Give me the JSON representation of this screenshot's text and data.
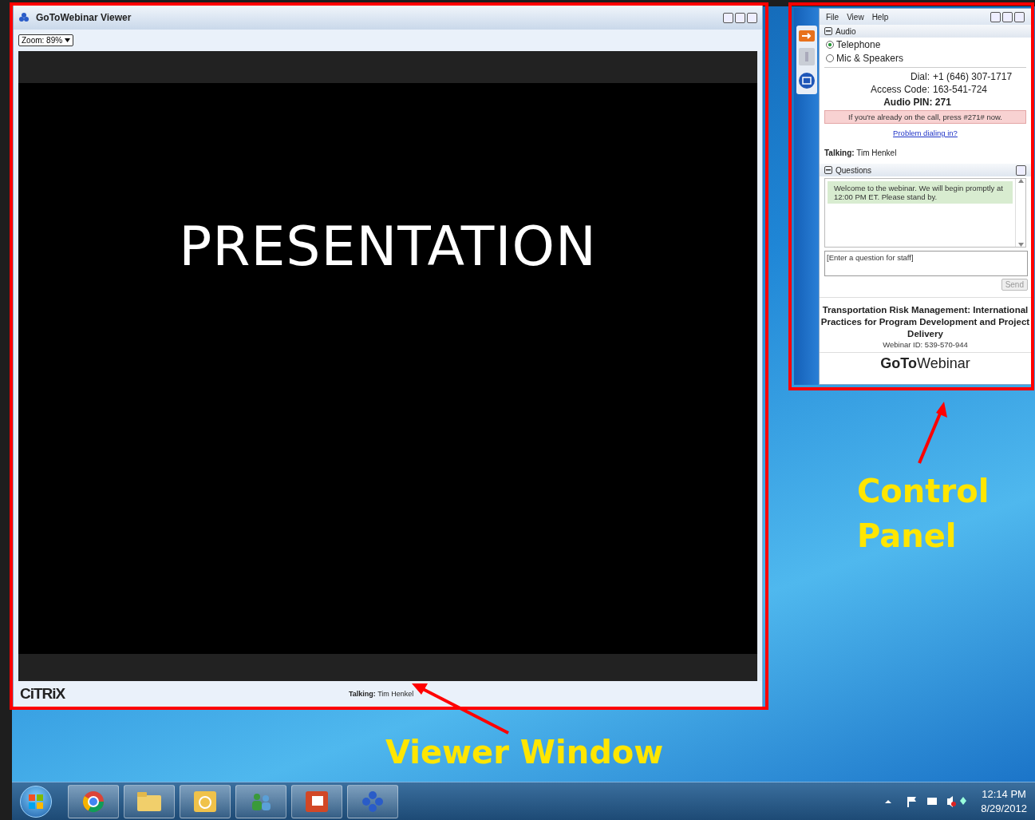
{
  "viewer": {
    "title": "GoToWebinar Viewer",
    "zoom": "Zoom: 89%",
    "slide_text": "PRESENTATION",
    "brand": "CiTRiX",
    "talking_label": "Talking:",
    "talking_name": "Tim Henkel"
  },
  "control_panel": {
    "menu": [
      "File",
      "View",
      "Help"
    ],
    "audio": {
      "heading": "Audio",
      "options": [
        {
          "label": "Telephone",
          "selected": true
        },
        {
          "label": "Mic & Speakers",
          "selected": false
        }
      ],
      "dial_label": "Dial:",
      "dial": "+1 (646) 307-1717",
      "access_label": "Access Code:",
      "access": "163-541-724",
      "pin": "Audio PIN: 271",
      "notice": "If you're already on the call, press #271# now.",
      "link": "Problem dialing in?"
    },
    "talking_label": "Talking:",
    "talking_name": "Tim Henkel",
    "questions": {
      "heading": "Questions",
      "messages": [
        "Welcome to the webinar.  We will begin promptly at 12:00 PM ET.  Please stand by."
      ],
      "placeholder": "[Enter a question for staff]",
      "send": "Send"
    },
    "webinar_title": "Transportation Risk Management: International Practices for Program Development and Project Delivery",
    "webinar_id": "Webinar ID: 539-570-944",
    "logo_bold": "GoTo",
    "logo_light": "Webinar"
  },
  "annotations": [
    {
      "label": "Viewer Window"
    },
    {
      "label": "Control Panel"
    }
  ],
  "taskbar": {
    "time": "12:14 PM",
    "date": "8/29/2012"
  }
}
